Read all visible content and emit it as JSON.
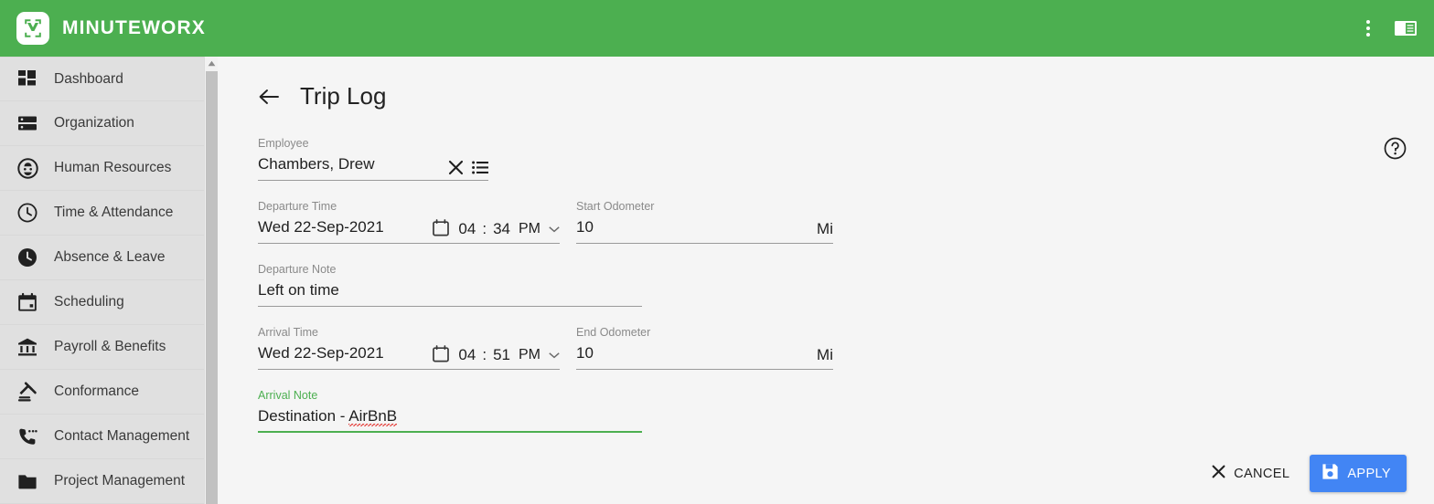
{
  "topbar": {
    "brand_name": "MINUTEWORX",
    "logo_icon": "minuteworx-logo-icon",
    "menu_icon": "more-vertical-icon",
    "panel_icon": "toggle-panel-icon"
  },
  "sidebar": {
    "items": [
      {
        "label": "Dashboard",
        "icon": "dashboard-grid-icon"
      },
      {
        "label": "Organization",
        "icon": "organization-server-icon"
      },
      {
        "label": "Human Resources",
        "icon": "person-circle-icon"
      },
      {
        "label": "Time & Attendance",
        "icon": "clock-outline-icon"
      },
      {
        "label": "Absence & Leave",
        "icon": "clock-filled-icon"
      },
      {
        "label": "Scheduling",
        "icon": "calendar-icon"
      },
      {
        "label": "Payroll & Benefits",
        "icon": "bank-icon"
      },
      {
        "label": "Conformance",
        "icon": "gavel-icon"
      },
      {
        "label": "Contact Management",
        "icon": "phone-icon"
      },
      {
        "label": "Project Management",
        "icon": "folder-icon"
      }
    ],
    "scroll_up_icon": "scroll-up-arrow-icon"
  },
  "page": {
    "title": "Trip Log",
    "back_icon": "back-arrow-icon",
    "help_icon": "help-circle-icon"
  },
  "form": {
    "employee": {
      "label": "Employee",
      "value": "Chambers, Drew",
      "clear_icon": "clear-x-icon",
      "list_icon": "list-picker-icon"
    },
    "departure_time": {
      "label": "Departure Time",
      "date": "Wed 22-Sep-2021",
      "hour": "04",
      "separator": ":",
      "minute": "34",
      "meridiem": "PM",
      "calendar_icon": "calendar-picker-icon",
      "dropdown_icon": "chevron-down-icon"
    },
    "start_odometer": {
      "label": "Start Odometer",
      "value": "10",
      "unit": "Mi"
    },
    "departure_note": {
      "label": "Departure Note",
      "value": "Left on time"
    },
    "arrival_time": {
      "label": "Arrival Time",
      "date": "Wed 22-Sep-2021",
      "hour": "04",
      "separator": ":",
      "minute": "51",
      "meridiem": "PM",
      "calendar_icon": "calendar-picker-icon",
      "dropdown_icon": "chevron-down-icon"
    },
    "end_odometer": {
      "label": "End Odometer",
      "value": "10",
      "unit": "Mi"
    },
    "arrival_note": {
      "label": "Arrival Note",
      "value_prefix": "Destination - ",
      "value_misspelled": "AirBnB",
      "focused": true
    }
  },
  "footer": {
    "cancel_label": "CANCEL",
    "cancel_icon": "close-x-icon",
    "apply_label": "APPLY",
    "apply_icon": "save-disk-icon"
  },
  "colors": {
    "brand_green": "#4caf50",
    "apply_blue": "#4285f4",
    "sidebar_bg": "#e0e0e0",
    "content_bg": "#f5f5f5",
    "spellcheck_red": "#e53935"
  }
}
